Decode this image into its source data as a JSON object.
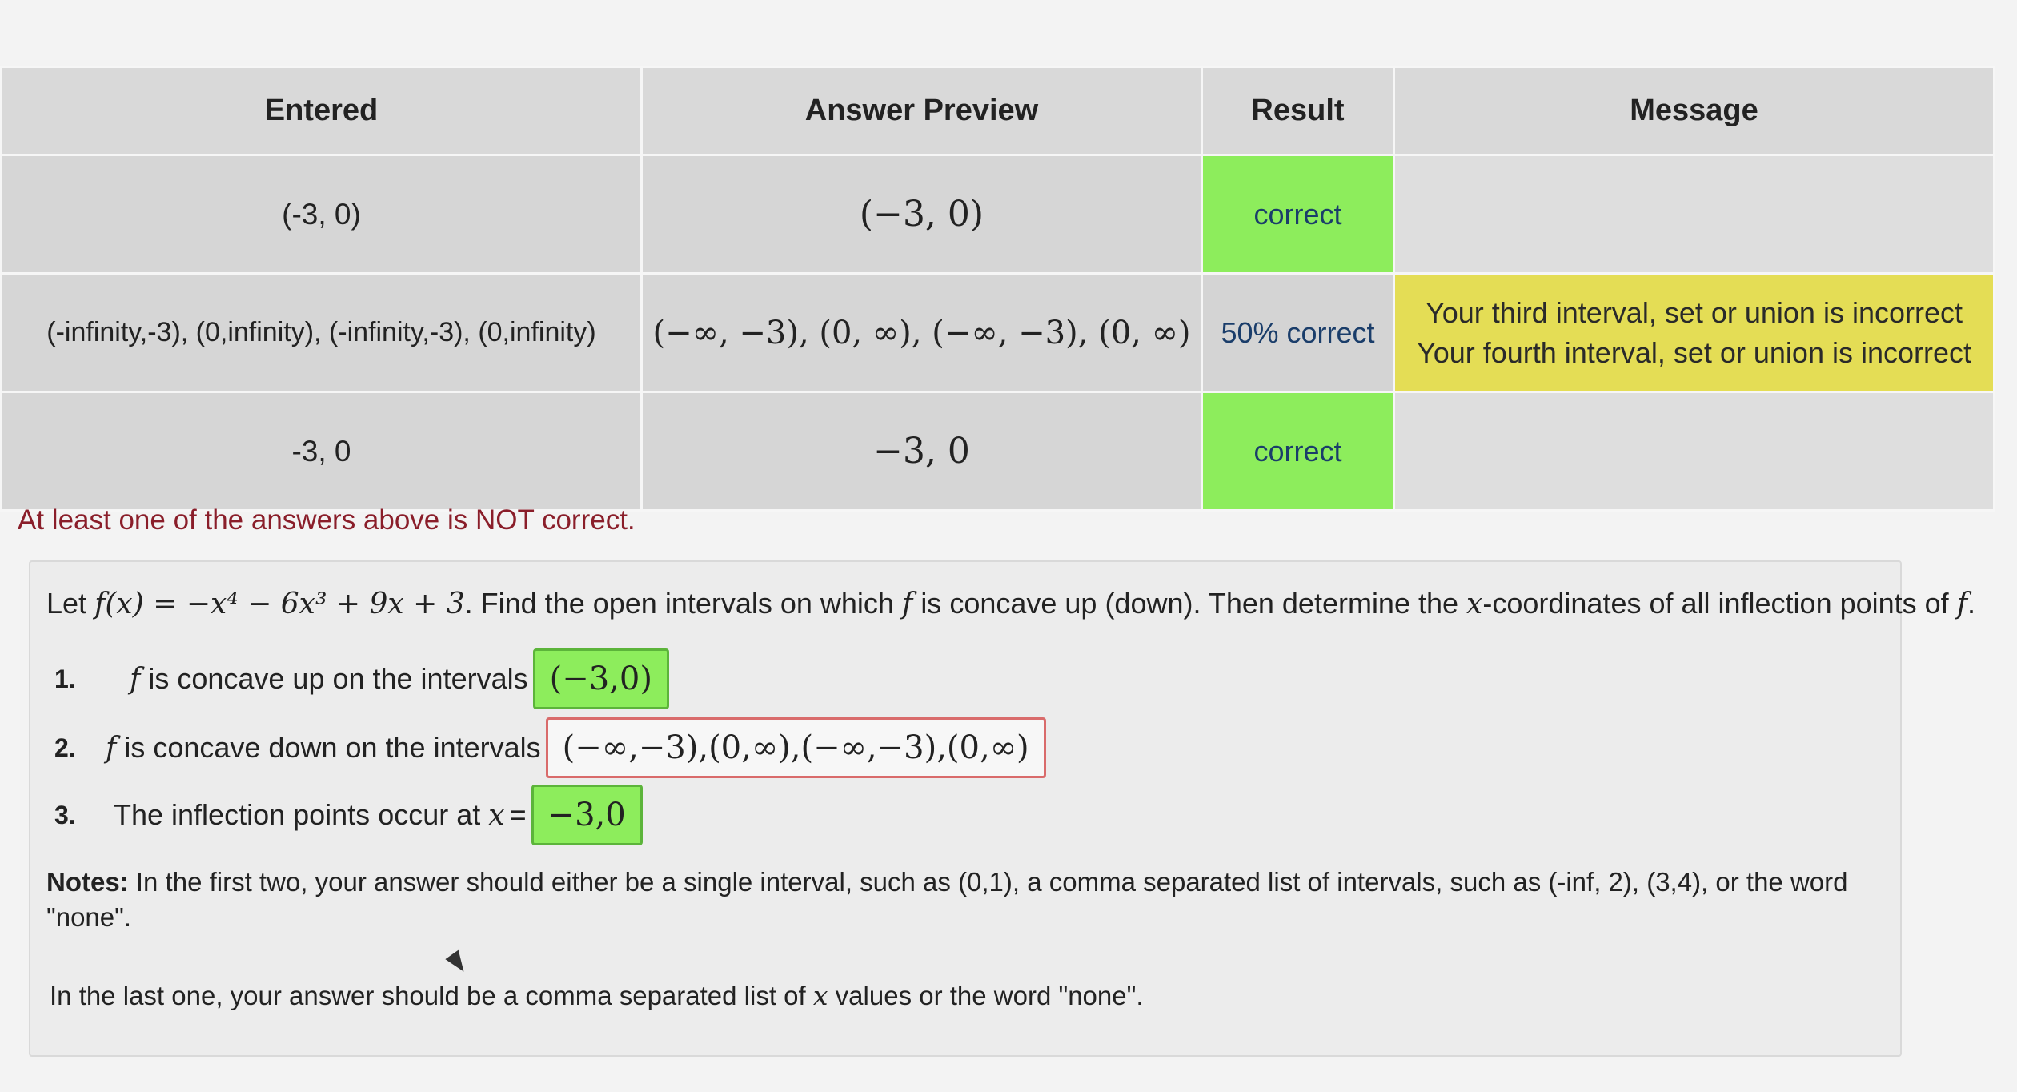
{
  "table": {
    "headers": [
      "Entered",
      "Answer Preview",
      "Result",
      "Message"
    ],
    "rows": [
      {
        "entered": "(-3, 0)",
        "preview": "(−3, 0)",
        "result": "correct",
        "message_line1": "",
        "message_line2": ""
      },
      {
        "entered": "(-infinity,-3), (0,infinity), (-infinity,-3), (0,infinity)",
        "preview": "(−∞, −3), (0, ∞), (−∞, −3), (0, ∞)",
        "result": "50% correct",
        "message_line1": "Your third interval, set or union is incorrect",
        "message_line2": "Your fourth interval, set or union is incorrect"
      },
      {
        "entered": "-3, 0",
        "preview": "−3, 0",
        "result": "correct",
        "message_line1": "",
        "message_line2": ""
      }
    ]
  },
  "status_message": "At least one of the answers above is NOT correct.",
  "problem": {
    "prefix": "Let",
    "function_def": "f(x) = −x⁴ − 6x³ + 9x + 3",
    "text_a": ". Find the open intervals on which",
    "f": "f",
    "text_b": "is concave up (down). Then determine the",
    "x": "x",
    "text_c": "-coordinates of all inflection points of",
    "f_end": "f",
    "text_d": ".",
    "questions": [
      {
        "num": "1.",
        "f": "f",
        "label": "is concave up on the intervals",
        "answer": "(−3,0)"
      },
      {
        "num": "2.",
        "f": "f",
        "label": "is concave down on the intervals",
        "answer": "(−∞,−3),(0,∞),(−∞,−3),(0,∞)"
      },
      {
        "num": "3.",
        "label": "The inflection points occur at",
        "x": "x",
        "eq": "=",
        "answer": "−3,0"
      }
    ],
    "notes_label": "Notes:",
    "notes_text": "In the first two, your answer should either be a single interval, such as (0,1), a comma separated list of intervals, such as (-inf, 2), (3,4), or the word \"none\".",
    "notes2_a": "In the last one, your answer should be a comma separated list of",
    "notes2_x": "x",
    "notes2_b": "values or the word \"none\"."
  },
  "colors": {
    "correct": "#8ded5c",
    "warning": "#e4dd55",
    "error_text": "#8a1e2a",
    "incorrect_border": "#d96b6b"
  }
}
